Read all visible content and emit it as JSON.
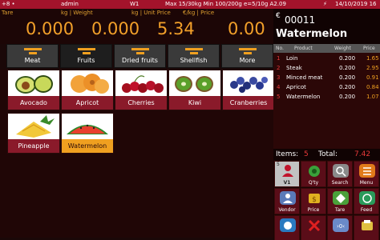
{
  "status": {
    "left": "+8 • ",
    "user": "admin",
    "scale": "W1",
    "range": "Max 15/30kg  Min 100/200g e=5/10g A2.09",
    "flash": "⚡",
    "datetime": "14/10/2019 16"
  },
  "display": {
    "tare_label": "Tare",
    "weight_label": "kg | Weight",
    "unit_label": "kg | Unit Price",
    "price_label": "€/kg | Price",
    "currency_mark": "€",
    "tare": "0.000",
    "weight": "0.000",
    "unit_price": "5.34",
    "price": "0.00"
  },
  "product": {
    "code": "00011",
    "name": "Watermelon"
  },
  "categories": [
    {
      "label": "Meat",
      "active": false
    },
    {
      "label": "Fruits",
      "active": true
    },
    {
      "label": "Dried fruits",
      "active": false
    },
    {
      "label": "Shellfish",
      "active": false
    },
    {
      "label": "More",
      "active": false
    }
  ],
  "products": [
    {
      "name": "Avocado",
      "icon": "avocado-icon"
    },
    {
      "name": "Apricot",
      "icon": "apricot-icon"
    },
    {
      "name": "Cherries",
      "icon": "cherries-icon"
    },
    {
      "name": "Kiwi",
      "icon": "kiwi-icon"
    },
    {
      "name": "Cranberries",
      "icon": "cranberries-icon"
    },
    {
      "name": "Pineapple",
      "icon": "pineapple-icon"
    },
    {
      "name": "Watermelon",
      "icon": "watermelon-icon"
    }
  ],
  "table": {
    "headers": [
      "No.",
      "Product",
      "Weight",
      "Price"
    ],
    "rows": [
      {
        "no": "1",
        "product": "Loin",
        "weight": "0.200",
        "price": "1.65"
      },
      {
        "no": "2",
        "product": "Steak",
        "weight": "0.200",
        "price": "2.95"
      },
      {
        "no": "3",
        "product": "Minced meat",
        "weight": "0.200",
        "price": "0.91"
      },
      {
        "no": "4",
        "product": "Apricot",
        "weight": "0.200",
        "price": "0.84"
      },
      {
        "no": "5",
        "product": "Watermelon",
        "weight": "0.200",
        "price": "1.07"
      }
    ]
  },
  "summary": {
    "items_label": "Items:",
    "items_count": "5",
    "total_label": "Total:",
    "total": "7.42"
  },
  "functions": [
    {
      "label": "V1",
      "badge": "5",
      "icon": "user-icon"
    },
    {
      "label": "Q'ty",
      "icon": "quantity-icon"
    },
    {
      "label": "Search",
      "icon": "search-icon"
    },
    {
      "label": "Menu",
      "icon": "menu-icon"
    },
    {
      "label": "Vendor",
      "icon": "vendor-icon"
    },
    {
      "label": "Price",
      "icon": "price-icon"
    },
    {
      "label": "Tare",
      "icon": "tare-icon"
    },
    {
      "label": "Feed",
      "icon": "feed-icon"
    },
    {
      "label": "",
      "icon": "clear-icon"
    },
    {
      "label": "",
      "icon": "delete-icon"
    },
    {
      "label": "",
      "icon": "zero-icon"
    },
    {
      "label": "",
      "icon": "print-icon"
    }
  ],
  "colors": {
    "accent": "#a3132b",
    "orange": "#f0a020",
    "tile_label": "#8a1a2a",
    "selected": "#f0a020",
    "dark": "#1a0808"
  }
}
